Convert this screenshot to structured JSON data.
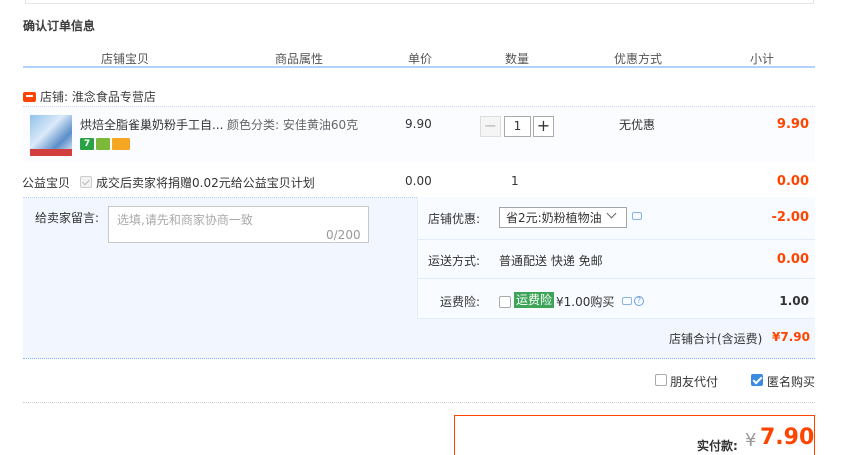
{
  "section_title": "确认订单信息",
  "columns": [
    "店铺宝贝",
    "商品属性",
    "单价",
    "数量",
    "优惠方式",
    "小计"
  ],
  "shop": {
    "label": "店铺:",
    "name": "淮念食品专营店"
  },
  "item": {
    "title": "烘焙全脂雀巢奶粉手工自...",
    "attr_label": "颜色分类:",
    "attr_value": "安佳黄油60克",
    "price": "9.90",
    "qty": "1",
    "minus": "−",
    "plus": "+",
    "promo": "无优惠",
    "subtotal": "9.90",
    "badges": [
      "7",
      "",
      ""
    ],
    "badge_colors": [
      "#2ba245",
      "#7cb93a",
      "#f5a623"
    ]
  },
  "charity": {
    "label": "公益宝贝",
    "text": "成交后卖家将捐赠0.02元给公益宝贝计划",
    "price": "0.00",
    "qty": "1",
    "subtotal": "0.00"
  },
  "memo": {
    "label": "给卖家留言:",
    "placeholder": "选填,请先和商家协商一致",
    "count": "0/200"
  },
  "shop_discount": {
    "label": "店铺优惠:",
    "selected": "省2元:奶粉植物油",
    "amount": "-2.00"
  },
  "shipping": {
    "label": "运送方式:",
    "method": "普通配送 快递 免邮",
    "amount": "0.00"
  },
  "insurance": {
    "label": "运费险:",
    "tag": "运费险",
    "text": "¥1.00购买",
    "amount": "1.00"
  },
  "shop_total": {
    "label": "店铺合计(含运费)",
    "amount": "¥7.90"
  },
  "options": {
    "friend_pay": "朋友代付",
    "anonymous": "匿名购买"
  },
  "payment": {
    "label": "实付款:",
    "currency": "¥",
    "amount": "7.90"
  },
  "colors": {
    "accent": "#ff4400",
    "header_line": "#b2d1ff",
    "panel_bg": "#f2f7ff",
    "insurance_tag": "#3ea558"
  }
}
